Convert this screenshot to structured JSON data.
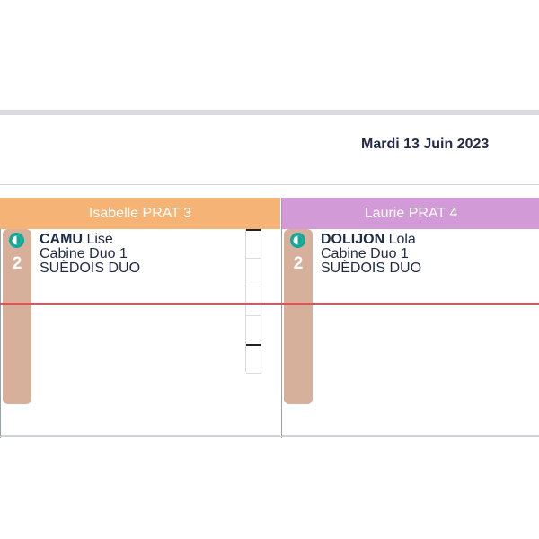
{
  "header": {
    "date": "Mardi 13 Juin 2023"
  },
  "columns": [
    {
      "name": "Isabelle PRAT 3",
      "header_color": "#f5b375",
      "event": {
        "count": "2",
        "last_name": "CAMU",
        "first_name": "Lise",
        "room": "Cabine Duo 1",
        "service": "SUÈDOIS DUO",
        "band_color": "#d6b09a",
        "status_icon": "half-moon-icon"
      }
    },
    {
      "name": "Laurie PRAT 4",
      "header_color": "#d39ad8",
      "event": {
        "count": "2",
        "last_name": "DOLIJON",
        "first_name": "Lola",
        "room": "Cabine Duo 1",
        "service": "SUÈDOIS DUO",
        "band_color": "#d6b09a",
        "status_icon": "half-moon-icon"
      }
    }
  ],
  "now_line_color": "#ef4b57"
}
